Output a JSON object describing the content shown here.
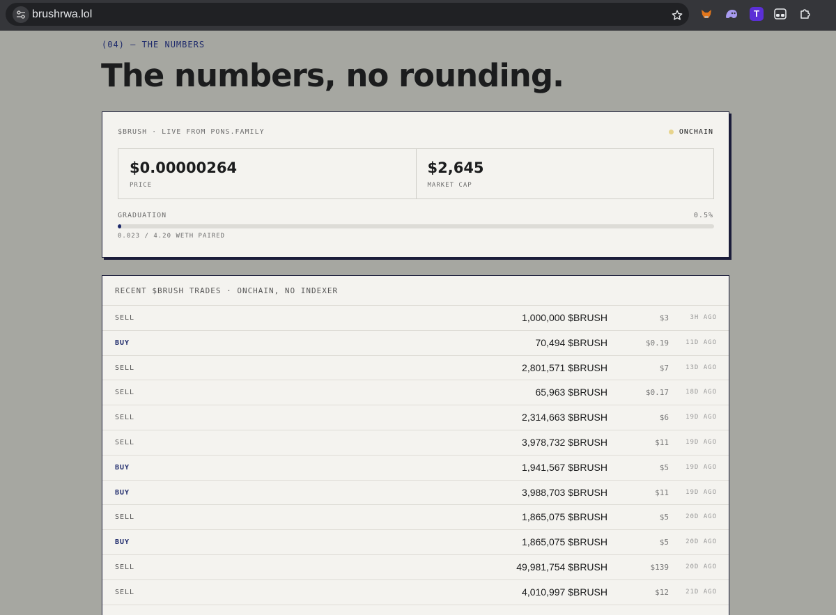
{
  "browser": {
    "url": "brushrwa.lol",
    "extensions": [
      "fox-extension-icon",
      "ghost-extension-icon",
      "T",
      "glasses-extension-icon",
      "puzzle-extensions-icon"
    ]
  },
  "page": {
    "kicker": "(04) — THE NUMBERS",
    "headline": "The numbers, no rounding."
  },
  "stats_card": {
    "label": "$BRUSH · LIVE FROM PONS.FAMILY",
    "status": "ONCHAIN",
    "status_color": "#e7d48c",
    "price_value": "$0.00000264",
    "price_label": "PRICE",
    "mcap_value": "$2,645",
    "mcap_label": "MARKET CAP",
    "graduation_label": "GRADUATION",
    "graduation_pct": "0.5%",
    "graduation_fraction": 0.005,
    "graduation_note": "0.023 / 4.20 WETH PAIRED"
  },
  "trades": {
    "title": "RECENT $BRUSH TRADES · ONCHAIN, NO INDEXER",
    "rows": [
      {
        "side": "SELL",
        "amount": "1,000,000 $BRUSH",
        "usd": "$3",
        "ago": "3H AGO"
      },
      {
        "side": "BUY",
        "amount": "70,494 $BRUSH",
        "usd": "$0.19",
        "ago": "11D AGO"
      },
      {
        "side": "SELL",
        "amount": "2,801,571 $BRUSH",
        "usd": "$7",
        "ago": "13D AGO"
      },
      {
        "side": "SELL",
        "amount": "65,963 $BRUSH",
        "usd": "$0.17",
        "ago": "18D AGO"
      },
      {
        "side": "SELL",
        "amount": "2,314,663 $BRUSH",
        "usd": "$6",
        "ago": "19D AGO"
      },
      {
        "side": "SELL",
        "amount": "3,978,732 $BRUSH",
        "usd": "$11",
        "ago": "19D AGO"
      },
      {
        "side": "BUY",
        "amount": "1,941,567 $BRUSH",
        "usd": "$5",
        "ago": "19D AGO"
      },
      {
        "side": "BUY",
        "amount": "3,988,703 $BRUSH",
        "usd": "$11",
        "ago": "19D AGO"
      },
      {
        "side": "SELL",
        "amount": "1,865,075 $BRUSH",
        "usd": "$5",
        "ago": "20D AGO"
      },
      {
        "side": "BUY",
        "amount": "1,865,075 $BRUSH",
        "usd": "$5",
        "ago": "20D AGO"
      },
      {
        "side": "SELL",
        "amount": "49,981,754 $BRUSH",
        "usd": "$139",
        "ago": "20D AGO"
      },
      {
        "side": "SELL",
        "amount": "4,010,997 $BRUSH",
        "usd": "$12",
        "ago": "21D AGO"
      }
    ]
  }
}
